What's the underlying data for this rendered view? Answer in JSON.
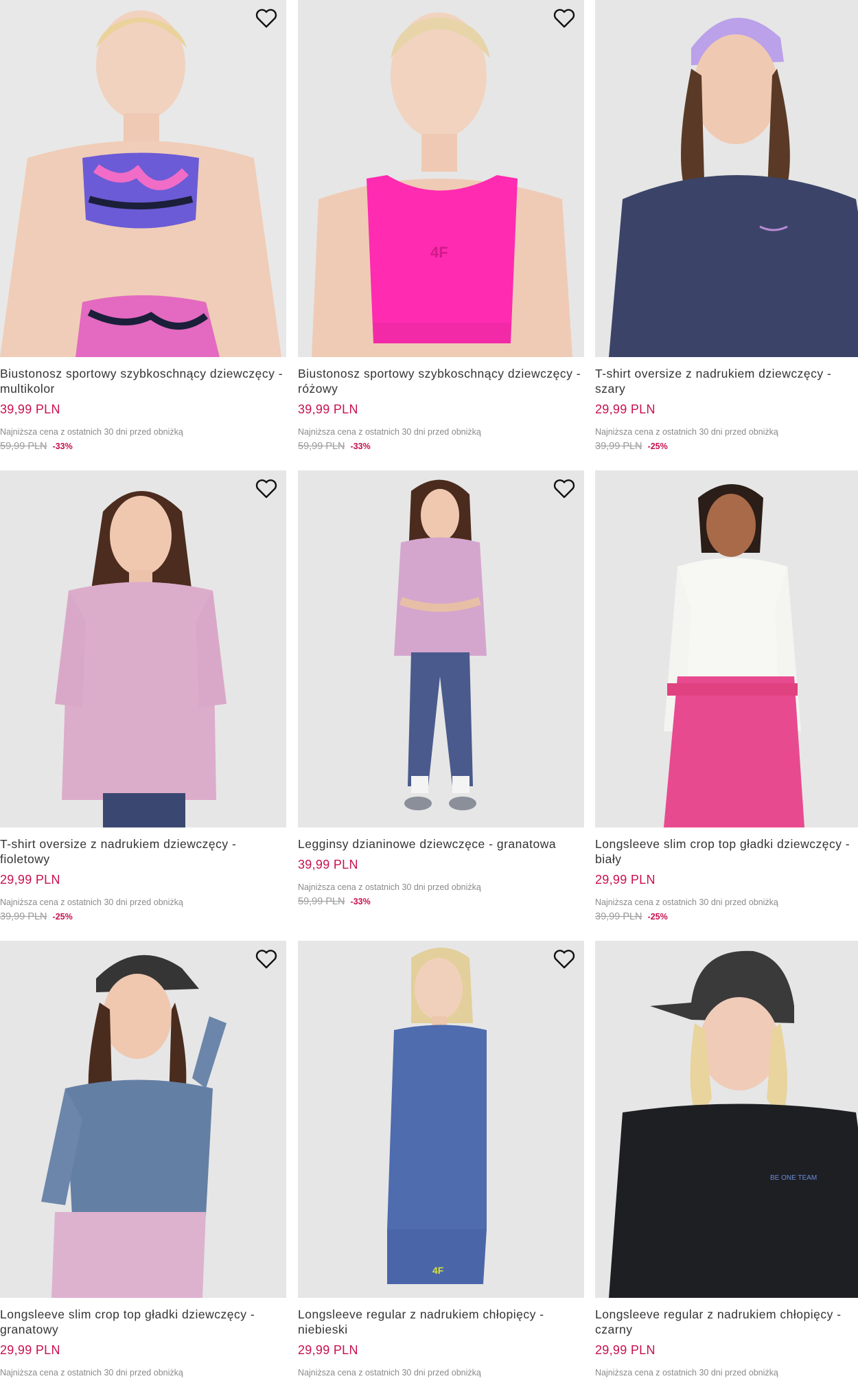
{
  "colors": {
    "price": "#c8104e",
    "text": "#333333",
    "muted": "#8a8a8a",
    "image_bg": "#e6e6e6"
  },
  "products": [
    {
      "title": "Biustonosz sportowy szybkoschnący dziewczęcy - multikolor",
      "price": "39,99 PLN",
      "lowest_label": "Najniższa cena z ostatnich 30 dni przed obniżką",
      "old_price": "59,99 PLN",
      "discount": "-33%",
      "image": "girl-multicolor-sport-bra",
      "wishlist_icon": "heart-outline-icon"
    },
    {
      "title": "Biustonosz sportowy szybkoschnący dziewczęcy - różowy",
      "price": "39,99 PLN",
      "lowest_label": "Najniższa cena z ostatnich 30 dni przed obniżką",
      "old_price": "59,99 PLN",
      "discount": "-33%",
      "image": "girl-pink-sport-bra",
      "wishlist_icon": "heart-outline-icon"
    },
    {
      "title": "T-shirt oversize z nadrukiem dziewczęcy - szary",
      "price": "29,99 PLN",
      "lowest_label": "Najniższa cena z ostatnich 30 dni przed obniżką",
      "old_price": "39,99 PLN",
      "discount": "-25%",
      "image": "girl-navy-tshirt-lilac-cap",
      "wishlist_icon": "heart-outline-icon"
    },
    {
      "title": "T-shirt oversize z nadrukiem dziewczęcy - fioletowy",
      "price": "29,99 PLN",
      "lowest_label": "Najniższa cena z ostatnich 30 dni przed obniżką",
      "old_price": "39,99 PLN",
      "discount": "-25%",
      "image": "girl-lilac-tshirt",
      "wishlist_icon": "heart-outline-icon"
    },
    {
      "title": "Legginsy dzianinowe dziewczęce - granatowa",
      "price": "39,99 PLN",
      "lowest_label": "Najniższa cena z ostatnich 30 dni przed obniżką",
      "old_price": "59,99 PLN",
      "discount": "-33%",
      "image": "girl-navy-leggings",
      "wishlist_icon": "heart-outline-icon"
    },
    {
      "title": "Longsleeve slim crop top gładki dziewczęcy - biały",
      "price": "29,99 PLN",
      "lowest_label": "Najniższa cena z ostatnich 30 dni przed obniżką",
      "old_price": "39,99 PLN",
      "discount": "-25%",
      "image": "girl-white-longsleeve",
      "wishlist_icon": "heart-outline-icon"
    },
    {
      "title": "Longsleeve slim crop top gładki dziewczęcy - granatowy",
      "price": "29,99 PLN",
      "lowest_label": "Najniższa cena z ostatnich 30 dni przed obniżką",
      "old_price": "",
      "discount": "",
      "image": "girl-blue-longsleeve-black-cap",
      "wishlist_icon": "heart-outline-icon"
    },
    {
      "title": "Longsleeve regular z nadrukiem chłopięcy - niebieski",
      "price": "29,99 PLN",
      "lowest_label": "Najniższa cena z ostatnich 30 dni przed obniżką",
      "old_price": "",
      "discount": "",
      "image": "boy-blue-longsleeve",
      "wishlist_icon": "heart-outline-icon"
    },
    {
      "title": "Longsleeve regular z nadrukiem chłopięcy - czarny",
      "price": "29,99 PLN",
      "lowest_label": "Najniższa cena z ostatnich 30 dni przed obniżką",
      "old_price": "",
      "discount": "",
      "image": "kid-black-longsleeve-black-cap",
      "wishlist_icon": "heart-outline-icon"
    }
  ]
}
